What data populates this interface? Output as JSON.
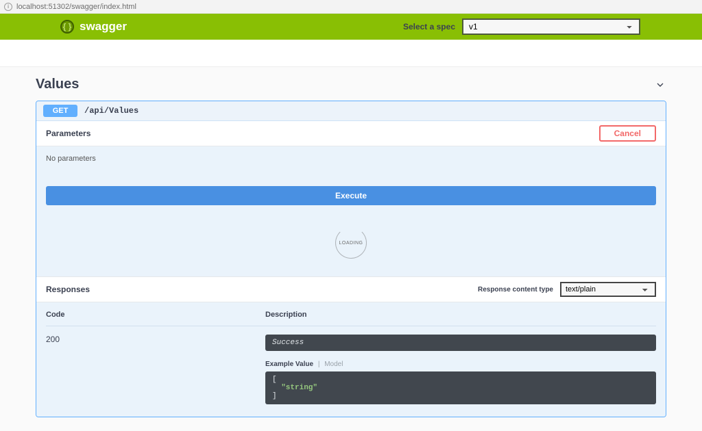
{
  "browser": {
    "url": "localhost:51302/swagger/index.html"
  },
  "topbar": {
    "brand": "swagger",
    "spec_label": "Select a spec",
    "spec_selected": "v1",
    "spec_options": [
      "v1"
    ]
  },
  "tag": {
    "name": "Values"
  },
  "operation": {
    "method": "GET",
    "path": "/api/Values",
    "parameters_label": "Parameters",
    "cancel_label": "Cancel",
    "no_parameters": "No parameters",
    "execute_label": "Execute",
    "loading_label": "LOADING"
  },
  "responses": {
    "header": "Responses",
    "content_type_label": "Response content type",
    "content_type_selected": "text/plain",
    "content_type_options": [
      "text/plain"
    ],
    "columns": {
      "code": "Code",
      "description": "Description"
    },
    "rows": [
      {
        "code": "200",
        "description": "Success",
        "example_label": "Example Value",
        "model_label": "Model",
        "example_json": "[\n  \"string\"\n]"
      }
    ]
  }
}
